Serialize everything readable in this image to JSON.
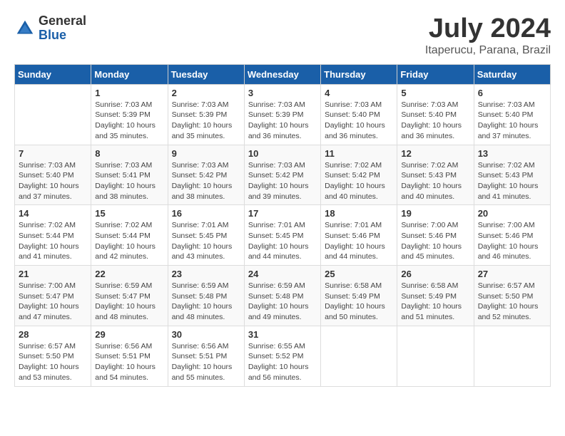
{
  "header": {
    "logo_general": "General",
    "logo_blue": "Blue",
    "month_year": "July 2024",
    "location": "Itaperucu, Parana, Brazil"
  },
  "columns": [
    "Sunday",
    "Monday",
    "Tuesday",
    "Wednesday",
    "Thursday",
    "Friday",
    "Saturday"
  ],
  "weeks": [
    [
      {
        "day": "",
        "info": ""
      },
      {
        "day": "1",
        "info": "Sunrise: 7:03 AM\nSunset: 5:39 PM\nDaylight: 10 hours\nand 35 minutes."
      },
      {
        "day": "2",
        "info": "Sunrise: 7:03 AM\nSunset: 5:39 PM\nDaylight: 10 hours\nand 35 minutes."
      },
      {
        "day": "3",
        "info": "Sunrise: 7:03 AM\nSunset: 5:39 PM\nDaylight: 10 hours\nand 36 minutes."
      },
      {
        "day": "4",
        "info": "Sunrise: 7:03 AM\nSunset: 5:40 PM\nDaylight: 10 hours\nand 36 minutes."
      },
      {
        "day": "5",
        "info": "Sunrise: 7:03 AM\nSunset: 5:40 PM\nDaylight: 10 hours\nand 36 minutes."
      },
      {
        "day": "6",
        "info": "Sunrise: 7:03 AM\nSunset: 5:40 PM\nDaylight: 10 hours\nand 37 minutes."
      }
    ],
    [
      {
        "day": "7",
        "info": "Sunrise: 7:03 AM\nSunset: 5:40 PM\nDaylight: 10 hours\nand 37 minutes."
      },
      {
        "day": "8",
        "info": "Sunrise: 7:03 AM\nSunset: 5:41 PM\nDaylight: 10 hours\nand 38 minutes."
      },
      {
        "day": "9",
        "info": "Sunrise: 7:03 AM\nSunset: 5:42 PM\nDaylight: 10 hours\nand 38 minutes."
      },
      {
        "day": "10",
        "info": "Sunrise: 7:03 AM\nSunset: 5:42 PM\nDaylight: 10 hours\nand 39 minutes."
      },
      {
        "day": "11",
        "info": "Sunrise: 7:02 AM\nSunset: 5:42 PM\nDaylight: 10 hours\nand 40 minutes."
      },
      {
        "day": "12",
        "info": "Sunrise: 7:02 AM\nSunset: 5:43 PM\nDaylight: 10 hours\nand 40 minutes."
      },
      {
        "day": "13",
        "info": "Sunrise: 7:02 AM\nSunset: 5:43 PM\nDaylight: 10 hours\nand 41 minutes."
      }
    ],
    [
      {
        "day": "14",
        "info": "Sunrise: 7:02 AM\nSunset: 5:44 PM\nDaylight: 10 hours\nand 41 minutes."
      },
      {
        "day": "15",
        "info": "Sunrise: 7:02 AM\nSunset: 5:44 PM\nDaylight: 10 hours\nand 42 minutes."
      },
      {
        "day": "16",
        "info": "Sunrise: 7:01 AM\nSunset: 5:45 PM\nDaylight: 10 hours\nand 43 minutes."
      },
      {
        "day": "17",
        "info": "Sunrise: 7:01 AM\nSunset: 5:45 PM\nDaylight: 10 hours\nand 44 minutes."
      },
      {
        "day": "18",
        "info": "Sunrise: 7:01 AM\nSunset: 5:46 PM\nDaylight: 10 hours\nand 44 minutes."
      },
      {
        "day": "19",
        "info": "Sunrise: 7:00 AM\nSunset: 5:46 PM\nDaylight: 10 hours\nand 45 minutes."
      },
      {
        "day": "20",
        "info": "Sunrise: 7:00 AM\nSunset: 5:46 PM\nDaylight: 10 hours\nand 46 minutes."
      }
    ],
    [
      {
        "day": "21",
        "info": "Sunrise: 7:00 AM\nSunset: 5:47 PM\nDaylight: 10 hours\nand 47 minutes."
      },
      {
        "day": "22",
        "info": "Sunrise: 6:59 AM\nSunset: 5:47 PM\nDaylight: 10 hours\nand 48 minutes."
      },
      {
        "day": "23",
        "info": "Sunrise: 6:59 AM\nSunset: 5:48 PM\nDaylight: 10 hours\nand 48 minutes."
      },
      {
        "day": "24",
        "info": "Sunrise: 6:59 AM\nSunset: 5:48 PM\nDaylight: 10 hours\nand 49 minutes."
      },
      {
        "day": "25",
        "info": "Sunrise: 6:58 AM\nSunset: 5:49 PM\nDaylight: 10 hours\nand 50 minutes."
      },
      {
        "day": "26",
        "info": "Sunrise: 6:58 AM\nSunset: 5:49 PM\nDaylight: 10 hours\nand 51 minutes."
      },
      {
        "day": "27",
        "info": "Sunrise: 6:57 AM\nSunset: 5:50 PM\nDaylight: 10 hours\nand 52 minutes."
      }
    ],
    [
      {
        "day": "28",
        "info": "Sunrise: 6:57 AM\nSunset: 5:50 PM\nDaylight: 10 hours\nand 53 minutes."
      },
      {
        "day": "29",
        "info": "Sunrise: 6:56 AM\nSunset: 5:51 PM\nDaylight: 10 hours\nand 54 minutes."
      },
      {
        "day": "30",
        "info": "Sunrise: 6:56 AM\nSunset: 5:51 PM\nDaylight: 10 hours\nand 55 minutes."
      },
      {
        "day": "31",
        "info": "Sunrise: 6:55 AM\nSunset: 5:52 PM\nDaylight: 10 hours\nand 56 minutes."
      },
      {
        "day": "",
        "info": ""
      },
      {
        "day": "",
        "info": ""
      },
      {
        "day": "",
        "info": ""
      }
    ]
  ]
}
